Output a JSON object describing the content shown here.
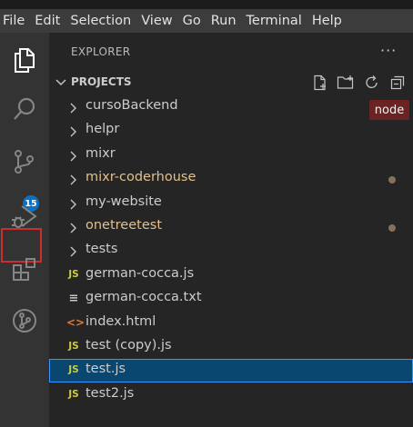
{
  "menubar": {
    "items": [
      "File",
      "Edit",
      "Selection",
      "View",
      "Go",
      "Run",
      "Terminal",
      "Help"
    ]
  },
  "activity_bar": {
    "icons": [
      "explorer-icon",
      "search-icon",
      "source-control-icon",
      "run-debug-icon",
      "extensions-icon",
      "git-graph-icon"
    ],
    "source_control_badge": "15"
  },
  "explorer": {
    "title": "EXPLORER",
    "more_actions": "···",
    "section_title": "PROJECTS",
    "header_actions": [
      "new-file-icon",
      "new-folder-icon",
      "refresh-icon",
      "collapse-all-icon"
    ],
    "tooltip": "node",
    "entries": [
      {
        "name": "cursoBackend",
        "type": "folder",
        "modified": false
      },
      {
        "name": "helpr",
        "type": "folder",
        "modified": false
      },
      {
        "name": "mixr",
        "type": "folder",
        "modified": false
      },
      {
        "name": "mixr-coderhouse",
        "type": "folder",
        "modified": true
      },
      {
        "name": "my-website",
        "type": "folder",
        "modified": false
      },
      {
        "name": "onetreetest",
        "type": "folder",
        "modified": true
      },
      {
        "name": "tests",
        "type": "folder",
        "modified": false
      },
      {
        "name": "german-cocca.js",
        "type": "js",
        "icon": "JS",
        "modified": false
      },
      {
        "name": "german-cocca.txt",
        "type": "txt",
        "icon": "≡",
        "modified": false
      },
      {
        "name": "index.html",
        "type": "html",
        "icon": "<>",
        "modified": false
      },
      {
        "name": "test (copy).js",
        "type": "js",
        "icon": "JS",
        "modified": false
      },
      {
        "name": "test.js",
        "type": "js",
        "icon": "JS",
        "modified": false,
        "selected": true
      },
      {
        "name": "test2.js",
        "type": "js",
        "icon": "JS",
        "modified": false
      }
    ]
  }
}
